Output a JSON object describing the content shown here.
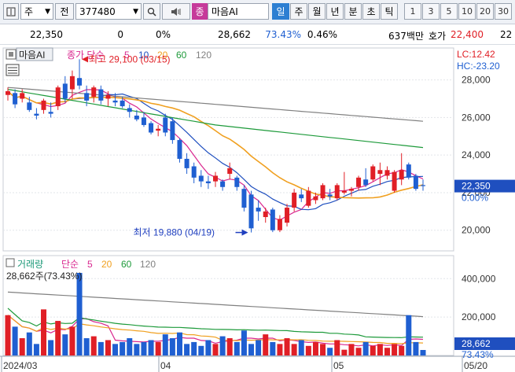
{
  "toolbar": {
    "type_label": "주",
    "jeon_label": "전",
    "code": "377480",
    "jong_label": "종",
    "stock_name": "마음AI",
    "periods": [
      "일",
      "주",
      "월",
      "년",
      "분",
      "초",
      "틱"
    ],
    "numbers": [
      "1",
      "3",
      "5",
      "10",
      "20",
      "30"
    ]
  },
  "quote": {
    "price": "22,350",
    "change": "0",
    "change_pct": "0%",
    "volume": "28,662",
    "volume_ratio": "73.43%",
    "turnover_pct": "0.46%",
    "amount": "637백만",
    "ask_label": "호가",
    "ask_price": "22,400",
    "extra": "22"
  },
  "price_pane": {
    "name_tag": "마음AI",
    "ma_label": "종가 단순",
    "ma_periods": [
      "5",
      "10",
      "20",
      "60",
      "120"
    ],
    "lc": "LC:12.42",
    "hc": "HC:-23.20",
    "high_annotation": "최고 29,100 (03/15)",
    "low_annotation": "최저 19,880 (04/19)",
    "current_price": "22,350",
    "current_change": "0.00%"
  },
  "volume_pane": {
    "label": "거래량",
    "ma_label": "단순",
    "ma_periods": [
      "5",
      "20",
      "60",
      "120"
    ],
    "current": "28,662주(73.43%)",
    "current_value": "28,662",
    "current_pct": "73.43%"
  },
  "x_axis": {
    "labels": [
      "2024/03",
      "04",
      "05",
      "05/20"
    ]
  },
  "colors": {
    "up": "#e01f26",
    "down": "#1f5fd1",
    "ma5": "#d9278f",
    "ma10": "#1f4fbf",
    "ma20": "#f0a020",
    "ma60": "#1d9a3a",
    "ma120": "#808080"
  },
  "chart_data": {
    "type": "candlestick",
    "price_ticks": [
      "28,000",
      "26,000",
      "24,000",
      "22,000",
      "20,000"
    ],
    "price_tick_values": [
      28000,
      26000,
      24000,
      22000,
      20000
    ],
    "price_ylim": [
      18900,
      29700
    ],
    "volume_ticks": [
      "400,000",
      "200,000"
    ],
    "volume_tick_values": [
      400000,
      200000
    ],
    "volume_ylim": [
      0,
      520000
    ],
    "candles": [
      {
        "o": 27200,
        "h": 27600,
        "l": 26900,
        "c": 27400
      },
      {
        "o": 27300,
        "h": 27500,
        "l": 26500,
        "c": 26700
      },
      {
        "o": 27000,
        "h": 27500,
        "l": 26800,
        "c": 27300
      },
      {
        "o": 26800,
        "h": 27100,
        "l": 26300,
        "c": 26400
      },
      {
        "o": 26200,
        "h": 26500,
        "l": 25900,
        "c": 26100
      },
      {
        "o": 26400,
        "h": 27000,
        "l": 26200,
        "c": 26900
      },
      {
        "o": 26300,
        "h": 26800,
        "l": 26000,
        "c": 26200
      },
      {
        "o": 26600,
        "h": 27700,
        "l": 26400,
        "c": 27600
      },
      {
        "o": 27800,
        "h": 28200,
        "l": 26800,
        "c": 27000
      },
      {
        "o": 27500,
        "h": 28500,
        "l": 27000,
        "c": 28200
      },
      {
        "o": 28100,
        "h": 29100,
        "l": 27500,
        "c": 27700
      },
      {
        "o": 27300,
        "h": 27700,
        "l": 26600,
        "c": 26900
      },
      {
        "o": 27100,
        "h": 27700,
        "l": 26800,
        "c": 27600
      },
      {
        "o": 27500,
        "h": 27700,
        "l": 26700,
        "c": 26900
      },
      {
        "o": 27000,
        "h": 27400,
        "l": 26600,
        "c": 27200
      },
      {
        "o": 26900,
        "h": 27300,
        "l": 26600,
        "c": 26800
      },
      {
        "o": 26900,
        "h": 27100,
        "l": 26500,
        "c": 26600
      },
      {
        "o": 26500,
        "h": 26700,
        "l": 26000,
        "c": 26300
      },
      {
        "o": 26100,
        "h": 26400,
        "l": 25800,
        "c": 25900
      },
      {
        "o": 26000,
        "h": 26300,
        "l": 25500,
        "c": 25600
      },
      {
        "o": 25700,
        "h": 25800,
        "l": 25100,
        "c": 25200
      },
      {
        "o": 25300,
        "h": 25600,
        "l": 25000,
        "c": 25400
      },
      {
        "o": 26000,
        "h": 26200,
        "l": 25000,
        "c": 25200
      },
      {
        "o": 25800,
        "h": 26000,
        "l": 24600,
        "c": 24800
      },
      {
        "o": 24800,
        "h": 24900,
        "l": 23600,
        "c": 23800
      },
      {
        "o": 23800,
        "h": 24100,
        "l": 23000,
        "c": 23300
      },
      {
        "o": 23400,
        "h": 23600,
        "l": 22500,
        "c": 22800
      },
      {
        "o": 22900,
        "h": 23200,
        "l": 22300,
        "c": 22600
      },
      {
        "o": 22600,
        "h": 22900,
        "l": 22200,
        "c": 22500
      },
      {
        "o": 22600,
        "h": 23100,
        "l": 22300,
        "c": 22900
      },
      {
        "o": 22600,
        "h": 22700,
        "l": 22100,
        "c": 22300
      },
      {
        "o": 23000,
        "h": 23600,
        "l": 22700,
        "c": 23300
      },
      {
        "o": 22800,
        "h": 22900,
        "l": 22100,
        "c": 22300
      },
      {
        "o": 22200,
        "h": 22400,
        "l": 21000,
        "c": 21200
      },
      {
        "o": 21900,
        "h": 22100,
        "l": 19880,
        "c": 20100
      },
      {
        "o": 21200,
        "h": 21600,
        "l": 20500,
        "c": 21000
      },
      {
        "o": 20700,
        "h": 21200,
        "l": 20400,
        "c": 21000
      },
      {
        "o": 21100,
        "h": 21200,
        "l": 19900,
        "c": 20000
      },
      {
        "o": 20000,
        "h": 20800,
        "l": 19900,
        "c": 20600
      },
      {
        "o": 20400,
        "h": 21400,
        "l": 20200,
        "c": 21200
      },
      {
        "o": 21200,
        "h": 22200,
        "l": 21000,
        "c": 22000
      },
      {
        "o": 21900,
        "h": 22200,
        "l": 21500,
        "c": 21700
      },
      {
        "o": 21300,
        "h": 22300,
        "l": 21200,
        "c": 22100
      },
      {
        "o": 21600,
        "h": 22000,
        "l": 21400,
        "c": 21800
      },
      {
        "o": 21700,
        "h": 22500,
        "l": 21600,
        "c": 22400
      },
      {
        "o": 21900,
        "h": 22200,
        "l": 21600,
        "c": 21800
      },
      {
        "o": 21700,
        "h": 22500,
        "l": 21600,
        "c": 22400
      },
      {
        "o": 22000,
        "h": 23100,
        "l": 21900,
        "c": 22100
      },
      {
        "o": 22100,
        "h": 22300,
        "l": 21800,
        "c": 22200
      },
      {
        "o": 22300,
        "h": 22900,
        "l": 22100,
        "c": 22800
      },
      {
        "o": 22700,
        "h": 23300,
        "l": 22300,
        "c": 22400
      },
      {
        "o": 22700,
        "h": 23500,
        "l": 22600,
        "c": 23400
      },
      {
        "o": 23000,
        "h": 23600,
        "l": 22400,
        "c": 23200
      },
      {
        "o": 22900,
        "h": 23400,
        "l": 22700,
        "c": 23200
      },
      {
        "o": 22100,
        "h": 23200,
        "l": 22000,
        "c": 23100
      },
      {
        "o": 22700,
        "h": 24100,
        "l": 22400,
        "c": 23200
      },
      {
        "o": 23500,
        "h": 23600,
        "l": 22700,
        "c": 22800
      },
      {
        "o": 22900,
        "h": 23000,
        "l": 22100,
        "c": 22200
      },
      {
        "o": 22400,
        "h": 22700,
        "l": 22100,
        "c": 22350
      }
    ],
    "volume": [
      210000,
      150000,
      90000,
      120000,
      60000,
      240000,
      80000,
      180000,
      110000,
      150000,
      430000,
      90000,
      100000,
      70000,
      80000,
      60000,
      70000,
      90000,
      60000,
      70000,
      80000,
      70000,
      110000,
      90000,
      120000,
      60000,
      70000,
      50000,
      80000,
      60000,
      100000,
      90000,
      70000,
      130000,
      60000,
      80000,
      110000,
      70000,
      60000,
      90000,
      60000,
      80000,
      50000,
      70000,
      60000,
      40000,
      80000,
      30000,
      60000,
      40000,
      70000,
      50000,
      60000,
      40000,
      60000,
      50000,
      210000,
      70000,
      28662
    ],
    "ma": {
      "ma120": {
        "first": 27600,
        "last": 25800
      },
      "ma60": {
        "first": 27500,
        "mid": 25600,
        "last": 24400
      }
    }
  }
}
